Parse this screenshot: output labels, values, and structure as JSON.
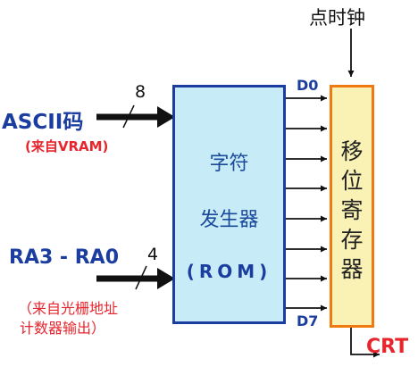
{
  "clock": {
    "label": "点时钟"
  },
  "inputs": {
    "ascii": {
      "label": "ASCII码",
      "source": "(来自VRAM)",
      "width": "8"
    },
    "row": {
      "label": "RA3 - RA0",
      "source_line1": "（来自光栅地址",
      "source_line2": "计数器输出）",
      "width": "4"
    }
  },
  "rom": {
    "line1": "字符",
    "line2": "发生器",
    "line3": "(ROM)"
  },
  "data_lines": {
    "top": "D0",
    "bottom": "D7"
  },
  "shift_register": {
    "chars": [
      "移",
      "位",
      "寄",
      "存",
      "器"
    ]
  },
  "output": {
    "label": "CRT"
  },
  "colors": {
    "rom_fill": "#c7ecf7",
    "rom_border": "#1b3da0",
    "shift_fill": "#faf2b4",
    "shift_border": "#f07a12",
    "red_text": "#e8242c",
    "blue_text": "#1b3da0"
  }
}
